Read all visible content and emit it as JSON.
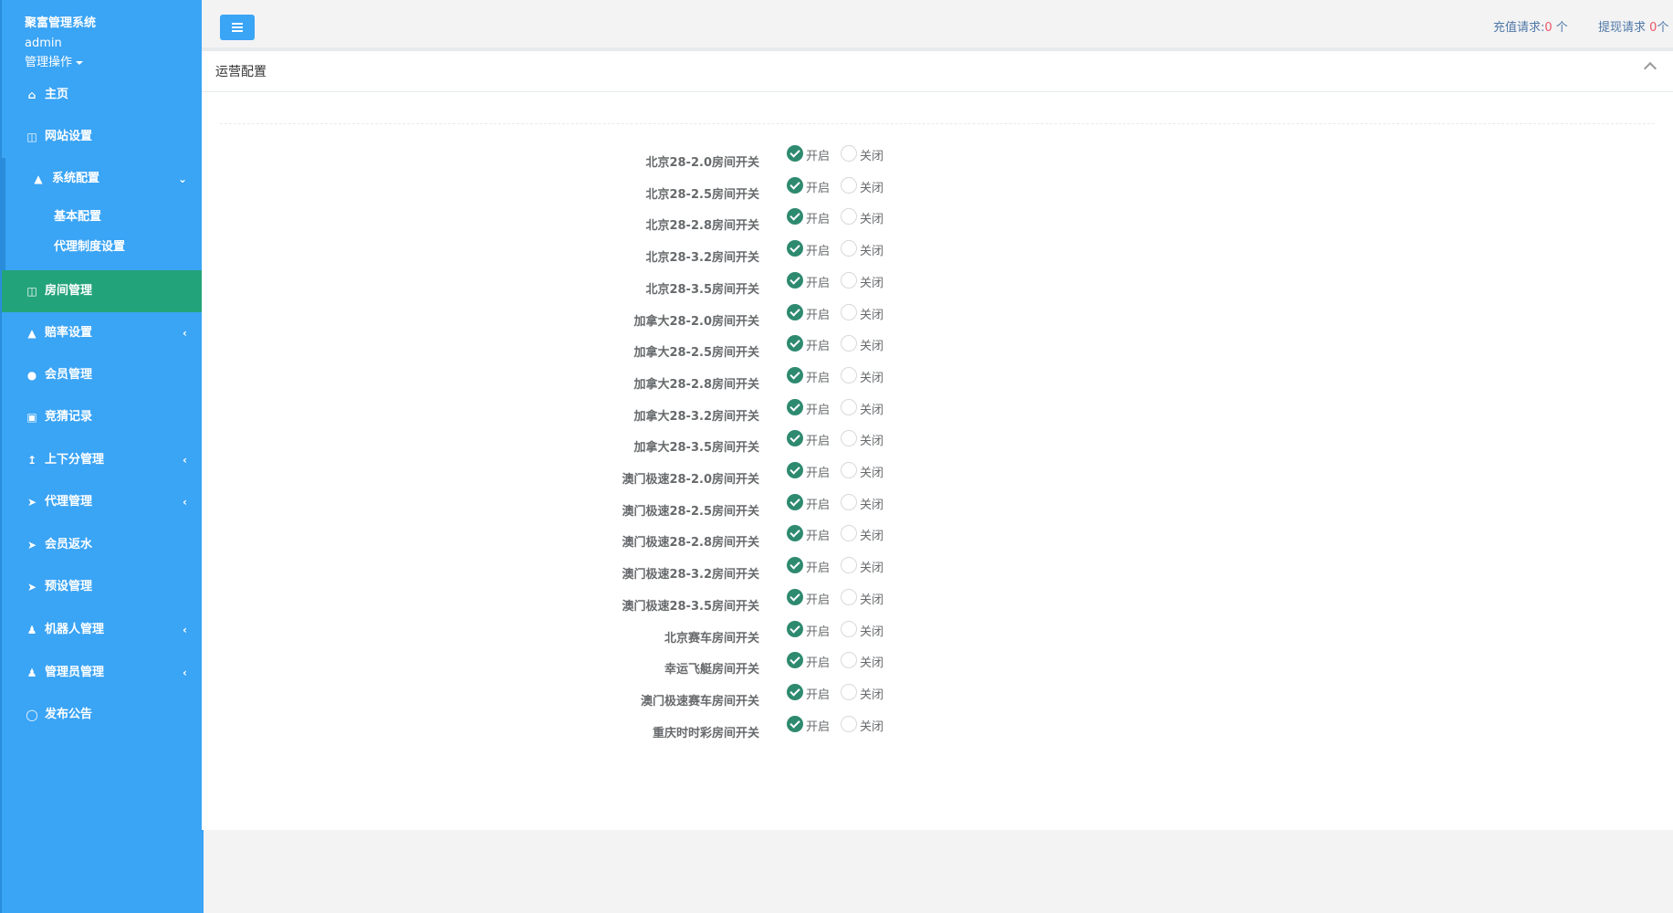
{
  "sidebar": {
    "brand": "聚富管理系统",
    "user": "admin",
    "user_menu": "管理操作",
    "nav": [
      {
        "label": "主页",
        "icon": "home-icon"
      },
      {
        "label": "网站设置",
        "icon": "columns-icon"
      },
      {
        "label": "系统配置",
        "icon": "flask-icon"
      },
      {
        "label": "房间管理",
        "icon": "columns-icon"
      },
      {
        "label": "赔率设置",
        "icon": "flask-icon"
      },
      {
        "label": "会员管理",
        "icon": "user-icon"
      },
      {
        "label": "竞猜记录",
        "icon": "car-icon"
      },
      {
        "label": "上下分管理",
        "icon": "level-up-icon"
      },
      {
        "label": "代理管理",
        "icon": "send-icon"
      },
      {
        "label": "会员返水",
        "icon": "send-icon"
      },
      {
        "label": "预设管理",
        "icon": "send-icon"
      },
      {
        "label": "机器人管理",
        "icon": "male-icon"
      },
      {
        "label": "管理员管理",
        "icon": "male-icon"
      },
      {
        "label": "发布公告",
        "icon": "comment-icon"
      }
    ],
    "sub_items": [
      {
        "label": "基本配置"
      },
      {
        "label": "代理制度设置"
      }
    ]
  },
  "topbar": {
    "recharge_label": "充值请求:",
    "recharge_count": "0",
    "recharge_unit": " 个",
    "withdraw_label": "提现请求",
    "withdraw_count": "0",
    "withdraw_unit": "个"
  },
  "panel": {
    "title": "运营配置",
    "on_label": "开启",
    "off_label": "关闭",
    "rows": [
      {
        "label": "北京28-2.0房间开关",
        "selected": "on"
      },
      {
        "label": "北京28-2.5房间开关",
        "selected": "on"
      },
      {
        "label": "北京28-2.8房间开关",
        "selected": "on"
      },
      {
        "label": "北京28-3.2房间开关",
        "selected": "on"
      },
      {
        "label": "北京28-3.5房间开关",
        "selected": "on"
      },
      {
        "label": "加拿大28-2.0房间开关",
        "selected": "on"
      },
      {
        "label": "加拿大28-2.5房间开关",
        "selected": "on"
      },
      {
        "label": "加拿大28-2.8房间开关",
        "selected": "on"
      },
      {
        "label": "加拿大28-3.2房间开关",
        "selected": "on"
      },
      {
        "label": "加拿大28-3.5房间开关",
        "selected": "on"
      },
      {
        "label": "澳门极速28-2.0房间开关",
        "selected": "on"
      },
      {
        "label": "澳门极速28-2.5房间开关",
        "selected": "on"
      },
      {
        "label": "澳门极速28-2.8房间开关",
        "selected": "on"
      },
      {
        "label": "澳门极速28-3.2房间开关",
        "selected": "on"
      },
      {
        "label": "澳门极速28-3.5房间开关",
        "selected": "on"
      },
      {
        "label": "北京赛车房间开关",
        "selected": "on"
      },
      {
        "label": "幸运飞艇房间开关",
        "selected": "on"
      },
      {
        "label": "澳门极速赛车房间开关",
        "selected": "on"
      },
      {
        "label": "重庆时时彩房间开关",
        "selected": "on"
      }
    ]
  }
}
